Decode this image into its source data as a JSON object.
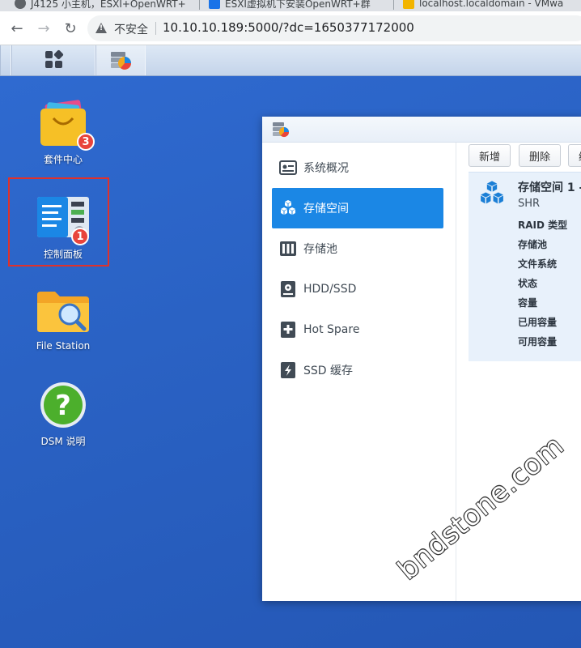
{
  "browser": {
    "tabs": [
      {
        "title": "J4125 小主机，ESXI+OpenWRT+"
      },
      {
        "title": "ESXI虚拟机下安装OpenWRT+群"
      },
      {
        "title": "localhost.localdomain - VMwa"
      }
    ],
    "security_label": "不安全",
    "url": "10.10.10.189:5000/?dc=1650377172000",
    "nav": {
      "back": "←",
      "forward": "→",
      "reload": "↻"
    }
  },
  "desktop": {
    "icons": [
      {
        "label": "套件中心",
        "badge": "3",
        "icon": "package-center-icon"
      },
      {
        "label": "控制面板",
        "badge": "1",
        "icon": "control-panel-icon"
      },
      {
        "label": "File Station",
        "icon": "folder-search-icon"
      },
      {
        "label": "DSM 说明",
        "icon": "help-icon"
      }
    ],
    "highlight_color": "#e0312b"
  },
  "window": {
    "sidebar": [
      {
        "label": "系统概况",
        "icon": "overview-icon",
        "active": false
      },
      {
        "label": "存储空间",
        "icon": "volume-cubes-icon",
        "active": true
      },
      {
        "label": "存储池",
        "icon": "storage-pool-icon",
        "active": false
      },
      {
        "label": "HDD/SSD",
        "icon": "disk-icon",
        "active": false
      },
      {
        "label": "Hot Spare",
        "icon": "hot-spare-icon",
        "active": false
      },
      {
        "label": "SSD 缓存",
        "icon": "ssd-cache-icon",
        "active": false
      }
    ],
    "toolbar": {
      "create": "新增",
      "delete": "删除",
      "more": "编"
    },
    "volume": {
      "title": "存储空间 1 -",
      "type": "SHR",
      "rows": [
        "RAID 类型",
        "存储池",
        "文件系统",
        "状态",
        "容量",
        "已用容量",
        "可用容量"
      ]
    },
    "accent_color": "#1b87e5"
  },
  "watermark": "bndstone.com"
}
